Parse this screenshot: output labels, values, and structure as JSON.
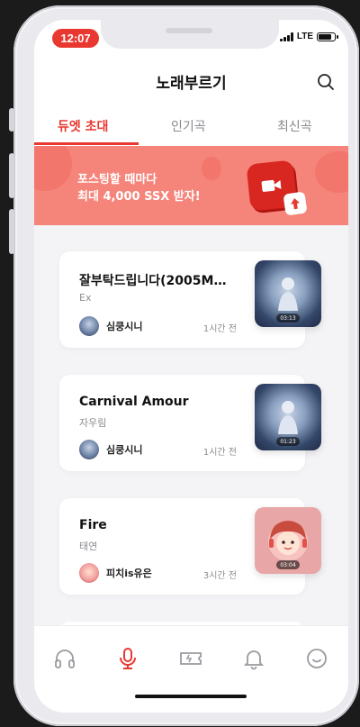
{
  "status_bar": {
    "time": "12:07",
    "network": "LTE"
  },
  "header": {
    "title": "노래부르기",
    "search_icon": "search-icon"
  },
  "tabs": [
    {
      "label": "듀엣 초대",
      "active": true
    },
    {
      "label": "인기곡",
      "active": false
    },
    {
      "label": "최신곡",
      "active": false
    }
  ],
  "banner": {
    "line1": "포스팅할 때마다",
    "line2": "최대 4,000 SSX 받자!",
    "icon": "video-camera-icon"
  },
  "cards": [
    {
      "title": "잘부탁드립니다(2005M…",
      "artist": "Ex",
      "user": "심쿵시니",
      "time": "1시간 전",
      "duration": "03:13"
    },
    {
      "title": "Carnival Amour",
      "artist": "자우림",
      "user": "심쿵시니",
      "time": "1시간 전",
      "duration": "01:23"
    },
    {
      "title": "Fire",
      "artist": "태연",
      "user": "피치is유은",
      "time": "3시간 전",
      "duration": "03:04"
    }
  ],
  "bottom_nav": [
    "headphones-icon",
    "microphone-icon",
    "ticket-icon",
    "bell-icon",
    "smile-icon"
  ],
  "colors": {
    "accent": "#e8382f",
    "banner": "#f5847a"
  }
}
